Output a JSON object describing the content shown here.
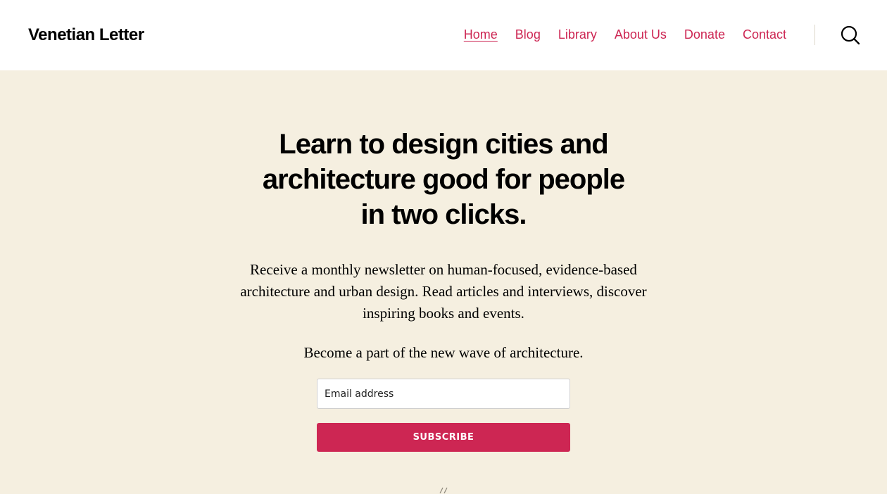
{
  "header": {
    "site_title": "Venetian Letter",
    "nav": [
      {
        "label": "Home",
        "current": true
      },
      {
        "label": "Blog"
      },
      {
        "label": "Library"
      },
      {
        "label": "About Us"
      },
      {
        "label": "Donate"
      },
      {
        "label": "Contact"
      }
    ],
    "search_icon": "search-icon"
  },
  "hero": {
    "headline_line1": "Learn to design cities and",
    "headline_line2": "architecture good for people",
    "headline_line3": "in two clicks.",
    "intro": "Receive a monthly newsletter on human-focused, evidence-based architecture and urban design. Read articles and interviews, discover inspiring books and events.",
    "tagline": "Become a part of the new wave of architecture.",
    "email_placeholder": "Email address",
    "subscribe_label": "SUBSCRIBE"
  },
  "colors": {
    "accent": "#cd2653",
    "background": "#f5efe0",
    "header_bg": "#ffffff",
    "text": "#000000"
  }
}
